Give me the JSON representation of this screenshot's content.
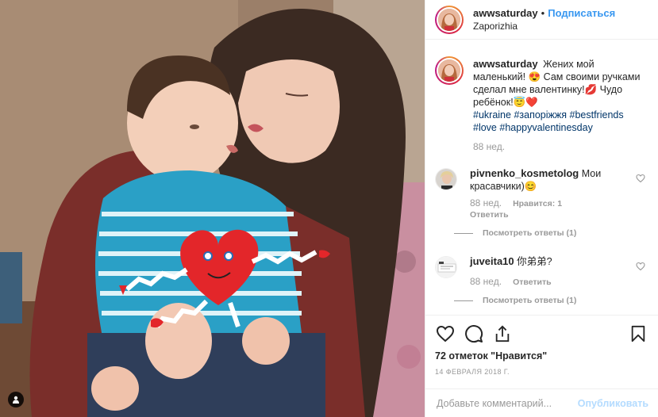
{
  "post": {
    "username": "awwsaturday",
    "dot": "•",
    "follow_label": "Подписаться",
    "location": "Zaporizhia",
    "photo_icons": [
      "user-tag-icon"
    ]
  },
  "caption": {
    "username": "awwsaturday",
    "text_1": "Жених мой маленький!",
    "emoji_1": "😍",
    "text_2": "Сам своими ручками сделал мне валентинку!",
    "emoji_2": "💋",
    "text_3": "Чудо ребёнок!",
    "emoji_3": "😇",
    "emoji_4": "❤️",
    "hashtags": [
      "#ukraine",
      "#запоріжжя",
      "#bestfriends",
      "#love",
      "#happyvalentinesday"
    ],
    "time": "88 нед."
  },
  "comments": [
    {
      "username": "pivnenko_kosmetolog",
      "text": "Мои красавчики)",
      "emoji": "😊",
      "time": "88 нед.",
      "likes": "Нравится: 1",
      "reply": "Ответить",
      "view_replies": "Посмотреть ответы (1)"
    },
    {
      "username": "juveita10",
      "text": "你弟弟?",
      "emoji": "",
      "time": "88 нед.",
      "likes": "",
      "reply": "Ответить",
      "view_replies": "Посмотреть ответы (1)"
    }
  ],
  "actions": {
    "icons": [
      "heart-icon",
      "comment-icon",
      "share-icon",
      "bookmark-icon"
    ],
    "likes_text": "72 отметок \"Нравится\"",
    "date": "14 февраля 2018 г."
  },
  "add_comment": {
    "placeholder": "Добавьте комментарий...",
    "post_label": "Опубликовать"
  },
  "colors": {
    "link_blue": "#3897f0",
    "hashtag": "#003569",
    "muted": "#999999",
    "post_disabled": "#b3dbff"
  }
}
